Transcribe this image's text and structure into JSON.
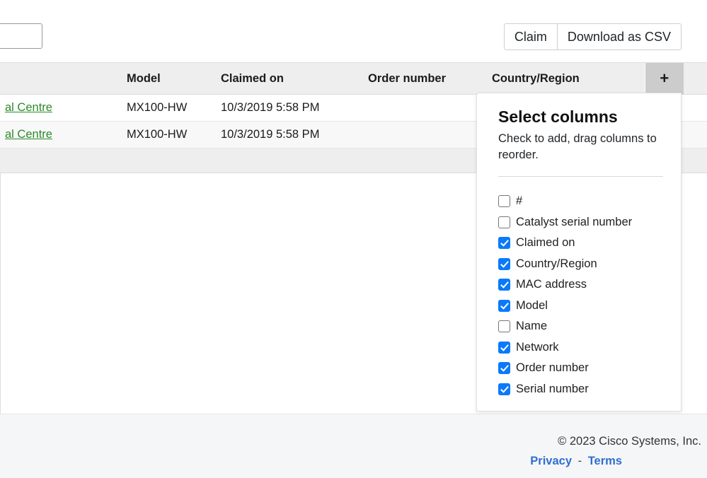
{
  "toolbar": {
    "search_value": "",
    "search_placeholder": "",
    "claim_label": "Claim",
    "download_label": "Download as CSV"
  },
  "table": {
    "columns": [
      "",
      "Model",
      "Claimed on",
      "Order number",
      "Country/Region"
    ],
    "add_column_icon": "+",
    "rows": [
      {
        "name": "al Centre",
        "model": "MX100-HW",
        "claimed_on": "10/3/2019 5:58 PM",
        "order_number": "",
        "country_region": ""
      },
      {
        "name": "al Centre",
        "model": "MX100-HW",
        "claimed_on": "10/3/2019 5:58 PM",
        "order_number": "",
        "country_region": ""
      }
    ],
    "summary": ""
  },
  "select_columns": {
    "title": "Select columns",
    "subtitle": "Check to add, drag columns to reorder.",
    "items": [
      {
        "label": "#",
        "checked": false
      },
      {
        "label": "Catalyst serial number",
        "checked": false
      },
      {
        "label": "Claimed on",
        "checked": true
      },
      {
        "label": "Country/Region",
        "checked": true
      },
      {
        "label": "MAC address",
        "checked": true
      },
      {
        "label": "Model",
        "checked": true
      },
      {
        "label": "Name",
        "checked": false
      },
      {
        "label": "Network",
        "checked": true
      },
      {
        "label": "Order number",
        "checked": true
      },
      {
        "label": "Serial number",
        "checked": true
      }
    ]
  },
  "footer": {
    "copyright": "© 2023 Cisco Systems, Inc.",
    "privacy_label": "Privacy",
    "separator": "-",
    "terms_label": "Terms"
  },
  "colors": {
    "accent_blue": "#0a7afb",
    "link_green": "#2a8b2a",
    "link_blue": "#2f6fd0",
    "header_gray": "#eeeeee",
    "plus_cell_gray": "#cccccc",
    "footer_gray": "#f5f6f7"
  }
}
